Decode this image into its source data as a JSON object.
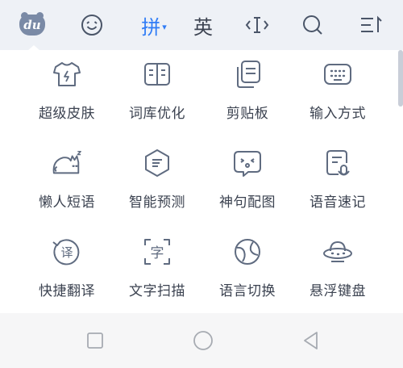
{
  "toolbar": {
    "logo_text": "du",
    "pinyin_label": "拼",
    "pinyin_caret": "▾",
    "english_label": "英",
    "icons": [
      "emoji-icon",
      "cursor-icon",
      "search-icon",
      "collapse-icon"
    ],
    "active_color": "#2f7cf6"
  },
  "panel": {
    "items": [
      {
        "label": "超级皮肤",
        "icon": "tshirt-icon"
      },
      {
        "label": "词库优化",
        "icon": "book-icon"
      },
      {
        "label": "剪贴板",
        "icon": "clipboard-icon"
      },
      {
        "label": "输入方式",
        "icon": "keyboard-icon"
      },
      {
        "label": "懒人短语",
        "icon": "cat-icon"
      },
      {
        "label": "智能预测",
        "icon": "predict-icon"
      },
      {
        "label": "神句配图",
        "icon": "sticker-icon"
      },
      {
        "label": "语音速记",
        "icon": "voice-note-icon"
      },
      {
        "label": "快捷翻译",
        "icon": "translate-icon"
      },
      {
        "label": "文字扫描",
        "icon": "scan-icon"
      },
      {
        "label": "语言切换",
        "icon": "globe-icon"
      },
      {
        "label": "悬浮键盘",
        "icon": "ufo-icon"
      }
    ],
    "icon_color": "#5f6b80"
  },
  "navbar": {
    "icons": [
      "back-icon",
      "home-icon",
      "recent-apps-icon"
    ]
  }
}
